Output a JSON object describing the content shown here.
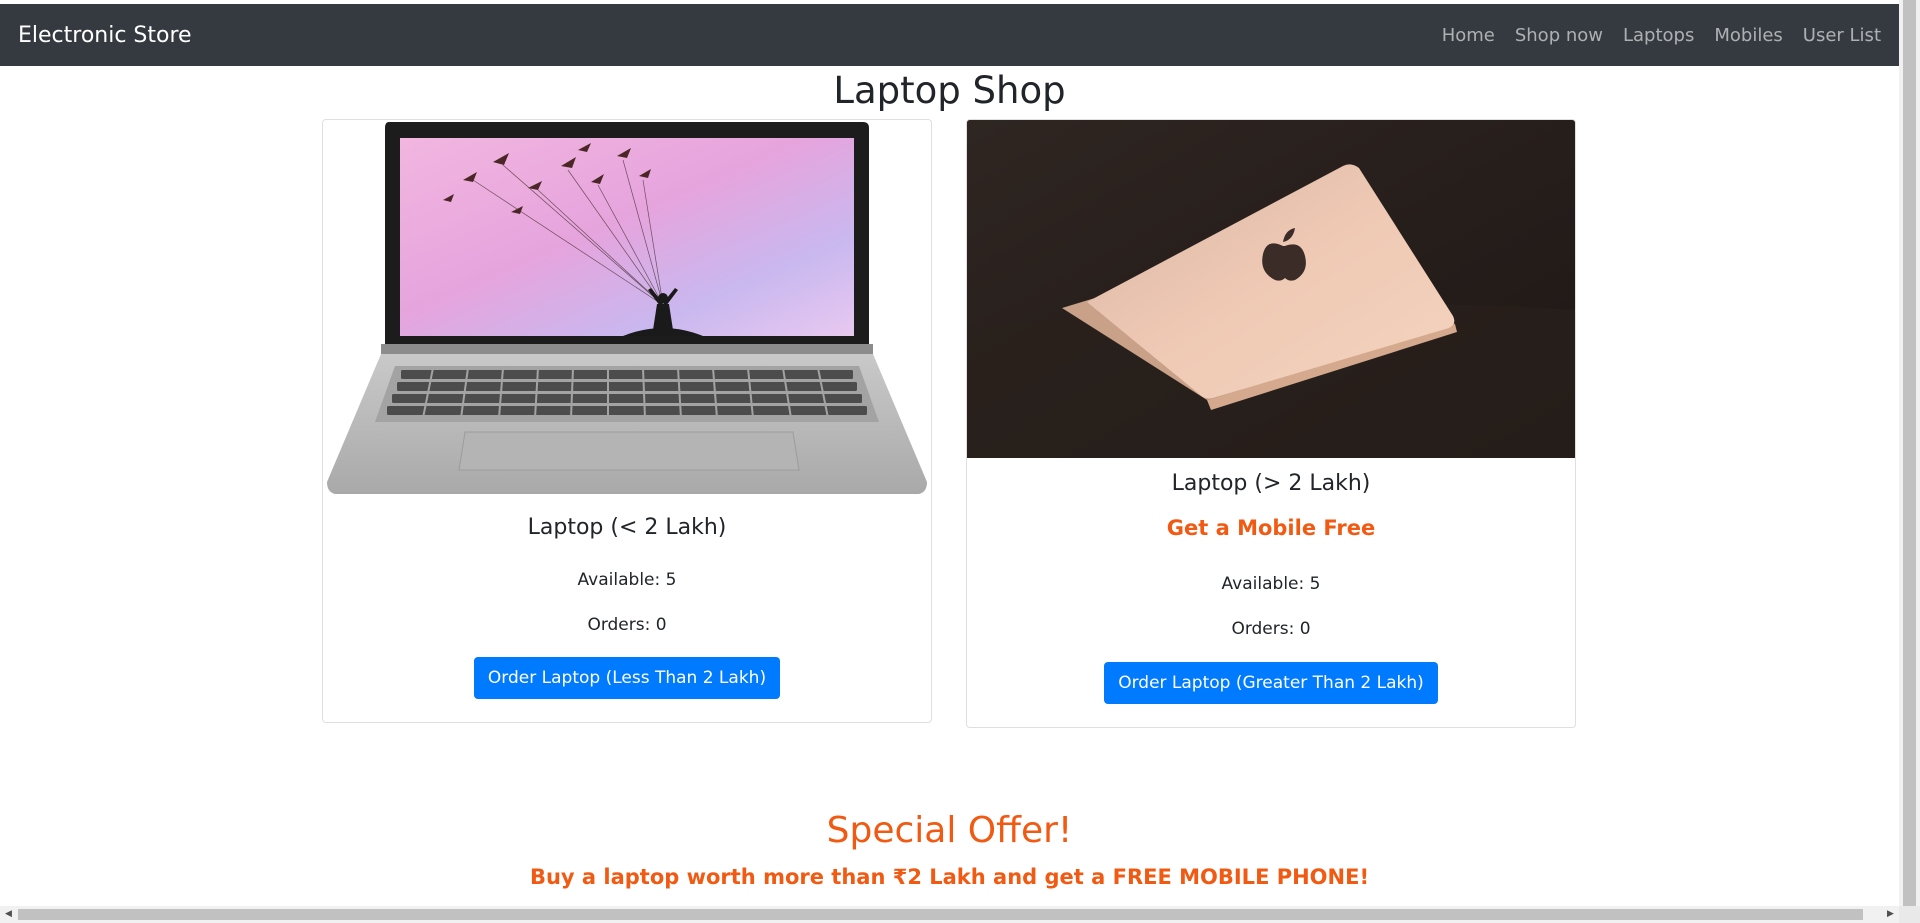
{
  "navbar": {
    "brand": "Electronic Store",
    "links": [
      "Home",
      "Shop now",
      "Laptops",
      "Mobiles",
      "User List"
    ]
  },
  "main": {
    "title": "Laptop Shop",
    "cards": [
      {
        "image_icon": "laptop-image",
        "title": "Laptop (< 2 Lakh)",
        "offer": "",
        "available": "Available: 5",
        "orders": "Orders: 0",
        "button": "Order Laptop (Less Than 2 Lakh)"
      },
      {
        "image_icon": "macbook-image",
        "title": "Laptop (> 2 Lakh)",
        "offer": "Get a Mobile Free",
        "available": "Available: 5",
        "orders": "Orders: 0",
        "button": "Order Laptop (Greater Than 2 Lakh)"
      }
    ]
  },
  "special_offer": {
    "heading": "Special Offer!",
    "text": "Buy a laptop worth more than ₹2 Lakh and get a FREE MOBILE PHONE!"
  },
  "colors": {
    "navbar_bg": "#343a40",
    "primary": "#007bff",
    "offer_orange": "#f15a13"
  }
}
